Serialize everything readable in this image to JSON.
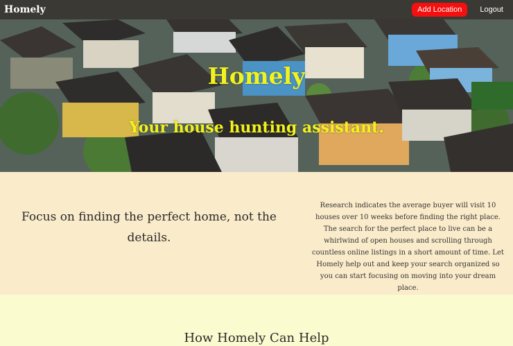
{
  "navbar": {
    "brand": "Homely",
    "add_location_label": "Add Location",
    "logout_label": "Logout"
  },
  "hero": {
    "title": "Homely",
    "subtitle": "Your house hunting assistant."
  },
  "focus": {
    "heading": "Focus on finding the perfect home, not the details.",
    "body": "Research indicates the average buyer will visit 10 houses over 10 weeks before finding the right place. The search for the perfect place to live can be a whirlwind of open houses and scrolling through countless online listings in a short amount of time. Let Homely help out and keep your search organized so you can start focusing on moving into your dream place."
  },
  "help": {
    "heading": "How Homely Can Help"
  },
  "colors": {
    "navbar": "#3b3934",
    "accent_button": "#f50f0f",
    "hero_text": "#f2f21f",
    "focus_bg": "#faebca",
    "help_bg": "#fbfbd0"
  }
}
